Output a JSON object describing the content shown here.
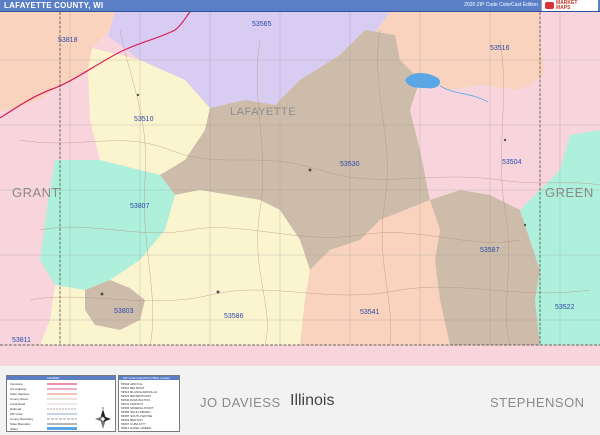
{
  "header": {
    "title": "LAFAYETTE COUNTY, WI",
    "edition": "2020 ZIP Code ColorCast Edition",
    "logo_text": "MARKET MAPS"
  },
  "map": {
    "county_name": "LAFAYETTE",
    "neighbor_counties": [
      "GRANT",
      "GREEN",
      "JO DAVIESS",
      "STEPHENSON"
    ],
    "state_label": "Illinois",
    "zip_codes": [
      "53818",
      "53565",
      "53516",
      "53510",
      "53530",
      "53504",
      "53807",
      "53587",
      "53803",
      "53586",
      "53541",
      "53522",
      "53811"
    ],
    "colors": {
      "lavender": "#d9ccf2",
      "peach": "#f9d3bd",
      "light_yellow": "#fbf5cf",
      "tan": "#cdbca9",
      "pink": "#f8d5dc",
      "mint": "#aef0dc",
      "water": "#5aa7e8",
      "road_red": "#d9205a",
      "outside": "#f2f2f2"
    }
  },
  "legend": {
    "title": "LEGEND",
    "rows": [
      "Interstate",
      "US Highway",
      "State Highway",
      "County Road",
      "Local Road",
      "Railroad",
      "ZIP Code",
      "County Boundary",
      "State Boundary",
      "Water"
    ]
  },
  "zip_table": {
    "title": "ZIP Code Index/Post Office Locator",
    "rows": [
      "53504 ARGYLE",
      "53510 BELMONT",
      "53516 BLANCHARDVILLE",
      "53522 BROWNTOWN",
      "53530 DARLINGTON",
      "53541 GRATIOT",
      "53565 MINERAL POINT",
      "53586 SHULLSBURG",
      "53587 SOUTH WAYNE",
      "53803 BENTON",
      "53807 CUBA CITY",
      "53811 HAZEL GREEN",
      "53818 PLATTEVILLE"
    ]
  }
}
